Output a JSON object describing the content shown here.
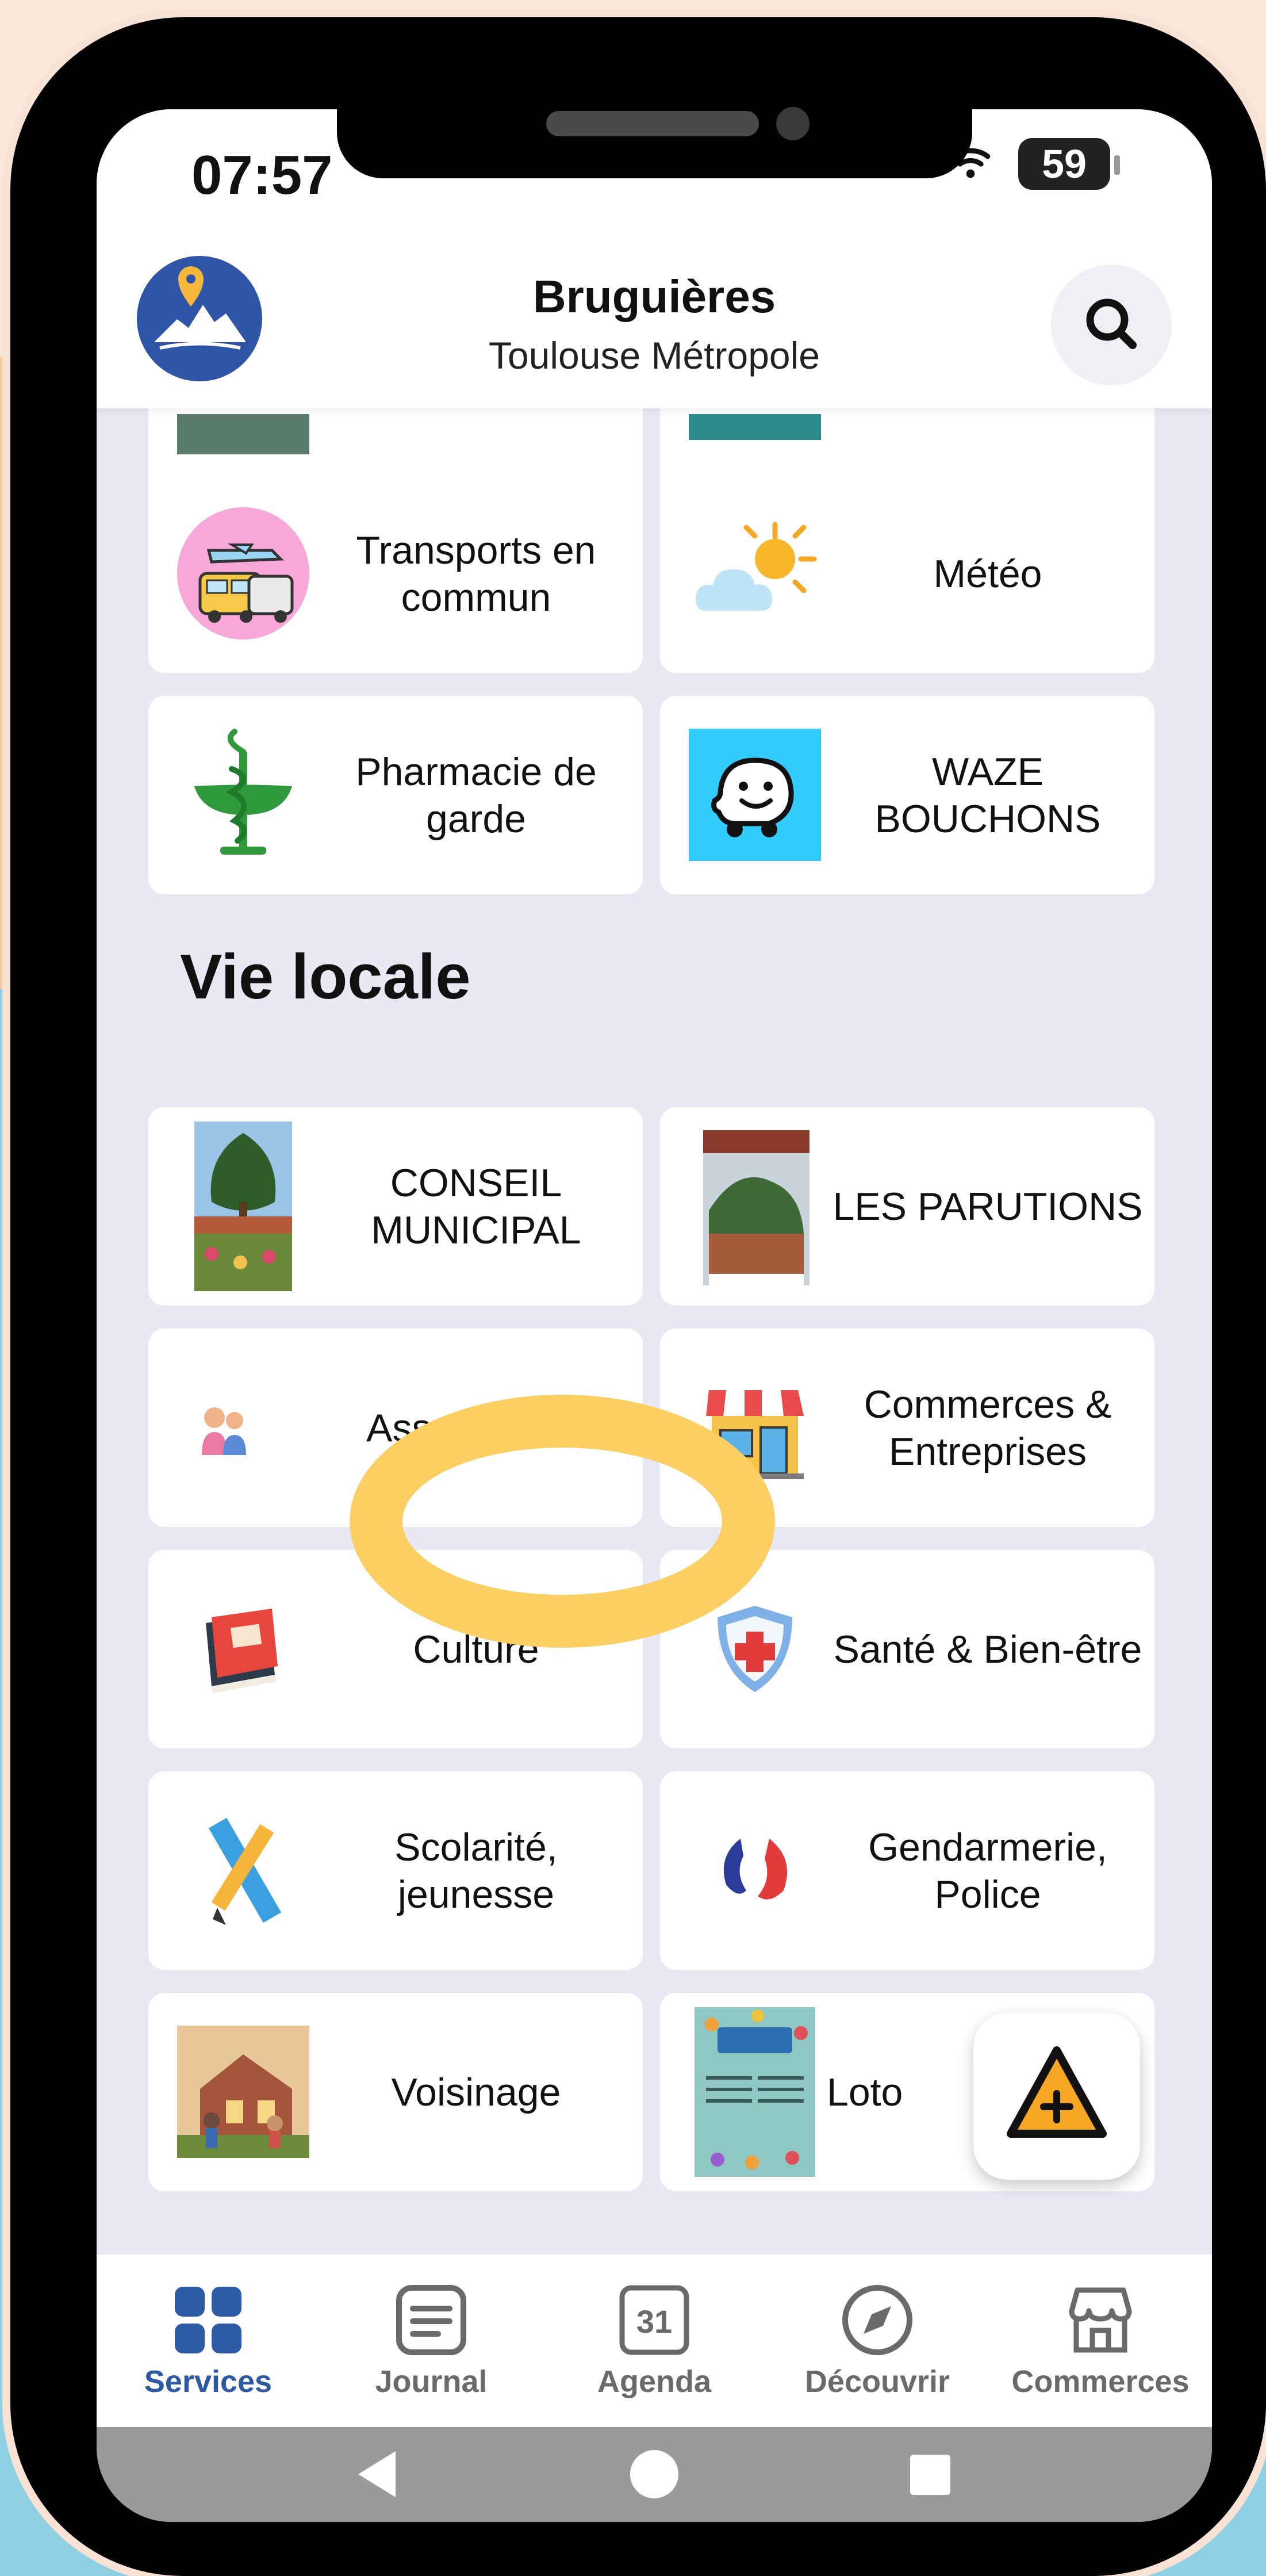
{
  "status": {
    "time": "07:57",
    "battery": "59"
  },
  "header": {
    "title": "Bruguières",
    "subtitle": "Toulouse Métropole"
  },
  "top_tiles": [
    {
      "label": "Transports en commun",
      "icon": "bus-plane-icon"
    },
    {
      "label": "Météo",
      "icon": "weather-icon"
    },
    {
      "label": "Pharmacie de garde",
      "icon": "pharmacy-icon"
    },
    {
      "label": "WAZE BOUCHONS",
      "icon": "waze-icon"
    }
  ],
  "section": {
    "title": "Vie locale"
  },
  "tiles": [
    {
      "label": "CONSEIL MUNICIPAL",
      "icon": "tree-photo"
    },
    {
      "label": "LES PARUTIONS",
      "icon": "magazine-cover"
    },
    {
      "label": "Associations",
      "icon": "people-icon"
    },
    {
      "label": "Commerces & Entreprises",
      "icon": "shop-icon"
    },
    {
      "label": "Culture",
      "icon": "book-icon"
    },
    {
      "label": "Santé & Bien-être",
      "icon": "health-shield-icon"
    },
    {
      "label": "Scolarité, jeunesse",
      "icon": "pencil-ruler-icon"
    },
    {
      "label": "Gendarmerie, Police",
      "icon": "police-icon"
    },
    {
      "label": "Voisinage",
      "icon": "neighbors-illustration"
    },
    {
      "label": "Loto",
      "icon": "lotos-poster"
    }
  ],
  "nav": [
    {
      "label": "Services",
      "icon": "grid-icon",
      "active": true
    },
    {
      "label": "Journal",
      "icon": "journal-icon"
    },
    {
      "label": "Agenda",
      "icon": "calendar-icon",
      "day": "31"
    },
    {
      "label": "Découvrir",
      "icon": "compass-icon"
    },
    {
      "label": "Commerces",
      "icon": "store-icon"
    }
  ],
  "colors": {
    "accent": "#2d5aa5",
    "highlight": "#fccf62",
    "background": "#e9e9f5"
  }
}
